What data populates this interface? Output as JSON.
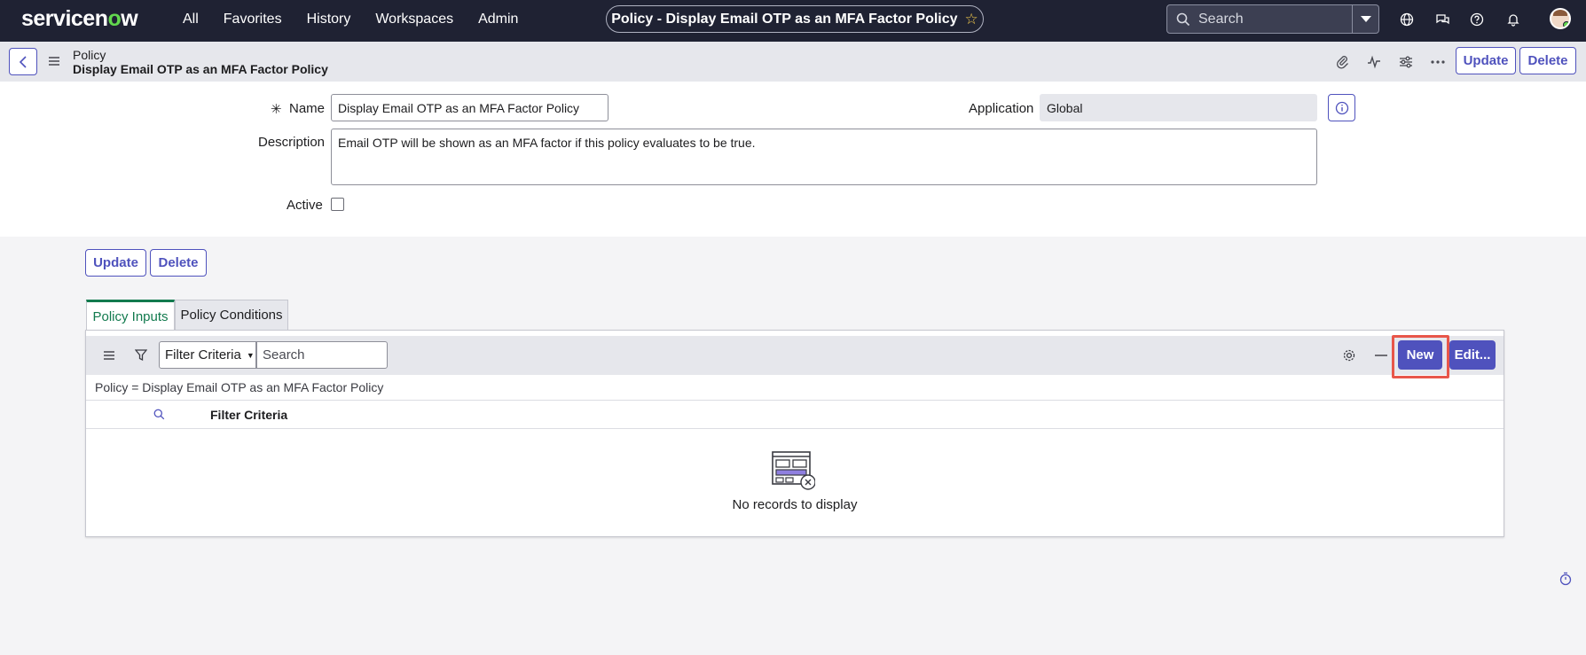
{
  "topnav": {
    "logo_prefix": "servicen",
    "logo_o": "o",
    "logo_suffix": "w",
    "links": [
      "All",
      "Favorites",
      "History",
      "Workspaces",
      "Admin"
    ],
    "record_title": "Policy - Display Email OTP as an MFA Factor Policy",
    "search_placeholder": "Search",
    "icons": [
      "globe-icon",
      "chat-icon",
      "help-icon",
      "bell-icon"
    ]
  },
  "header": {
    "table_label": "Policy",
    "record_name": "Display Email OTP as an MFA Factor Policy",
    "update_label": "Update",
    "delete_label": "Delete",
    "icons": [
      "paperclip-icon",
      "activity-icon",
      "sliders-icon",
      "more-icon"
    ]
  },
  "form": {
    "name_label": "Name",
    "name_value": "Display Email OTP as an MFA Factor Policy",
    "application_label": "Application",
    "application_value": "Global",
    "description_label": "Description",
    "description_value": "Email OTP will be shown as an MFA factor if this policy evaluates to be true.",
    "active_label": "Active",
    "active_checked": false,
    "update_label": "Update",
    "delete_label": "Delete"
  },
  "tabs": [
    {
      "label": "Policy Inputs",
      "active": true
    },
    {
      "label": "Policy Conditions",
      "active": false
    }
  ],
  "list": {
    "filter_field": "Filter Criteria",
    "search_placeholder": "Search",
    "new_label": "New",
    "edit_label": "Edit...",
    "breadcrumb": "Policy = Display Email OTP as an MFA Factor Policy",
    "columns": [
      "Filter Criteria"
    ],
    "empty_message": "No records to display"
  },
  "colors": {
    "nav_bg": "#1f2233",
    "accent": "#4f52bd",
    "tab_active": "#127a4e",
    "highlight": "#e8564a"
  }
}
